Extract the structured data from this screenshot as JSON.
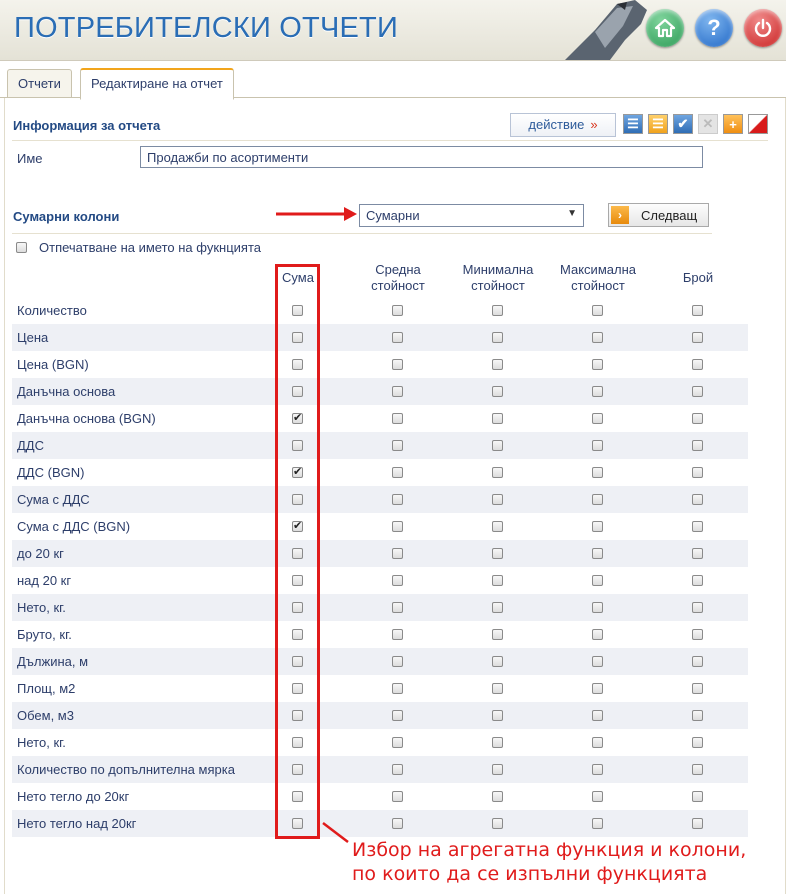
{
  "header": {
    "title": "ПОТРЕБИТЕЛСКИ ОТЧЕТИ",
    "buttons": [
      "home-icon",
      "help-icon",
      "power-icon"
    ]
  },
  "tabs": [
    {
      "label": "Отчети",
      "active": false
    },
    {
      "label": "Редактиране на отчет",
      "active": true
    }
  ],
  "info": {
    "title": "Информация за отчета",
    "action_label": "действие",
    "action_arrow": "»",
    "name_label": "Име",
    "name_value": "Продажби по асортименти"
  },
  "summary": {
    "title": "Сумарни колони",
    "select_value": "Сумарни",
    "next_label": "Следващ",
    "print_function_label": "Отпечатване на името на фукнцията"
  },
  "columns": [
    {
      "line1": "Сума",
      "line2": ""
    },
    {
      "line1": "Средна",
      "line2": "стойност"
    },
    {
      "line1": "Минимална",
      "line2": "стойност"
    },
    {
      "line1": "Максимална",
      "line2": "стойност"
    },
    {
      "line1": "Брой",
      "line2": ""
    }
  ],
  "rows": [
    {
      "name": "Количество",
      "checks": [
        false,
        false,
        false,
        false,
        false
      ]
    },
    {
      "name": "Цена",
      "checks": [
        false,
        false,
        false,
        false,
        false
      ]
    },
    {
      "name": "Цена (BGN)",
      "checks": [
        false,
        false,
        false,
        false,
        false
      ]
    },
    {
      "name": "Данъчна основа",
      "checks": [
        false,
        false,
        false,
        false,
        false
      ]
    },
    {
      "name": "Данъчна основа (BGN)",
      "checks": [
        true,
        false,
        false,
        false,
        false
      ]
    },
    {
      "name": "ДДС",
      "checks": [
        false,
        false,
        false,
        false,
        false
      ]
    },
    {
      "name": "ДДС (BGN)",
      "checks": [
        true,
        false,
        false,
        false,
        false
      ]
    },
    {
      "name": "Сума с ДДС",
      "checks": [
        false,
        false,
        false,
        false,
        false
      ]
    },
    {
      "name": "Сума с ДДС (BGN)",
      "checks": [
        true,
        false,
        false,
        false,
        false
      ]
    },
    {
      "name": "до 20 кг",
      "checks": [
        false,
        false,
        false,
        false,
        false
      ]
    },
    {
      "name": "над 20 кг",
      "checks": [
        false,
        false,
        false,
        false,
        false
      ]
    },
    {
      "name": "Нето, кг.",
      "checks": [
        false,
        false,
        false,
        false,
        false
      ]
    },
    {
      "name": "Бруто, кг.",
      "checks": [
        false,
        false,
        false,
        false,
        false
      ]
    },
    {
      "name": "Дължина, м",
      "checks": [
        false,
        false,
        false,
        false,
        false
      ]
    },
    {
      "name": "Площ, м2",
      "checks": [
        false,
        false,
        false,
        false,
        false
      ]
    },
    {
      "name": "Обем, м3",
      "checks": [
        false,
        false,
        false,
        false,
        false
      ]
    },
    {
      "name": "Нето, кг.",
      "checks": [
        false,
        false,
        false,
        false,
        false
      ]
    },
    {
      "name": "Количество по допълнителна мярка",
      "checks": [
        false,
        false,
        false,
        false,
        false
      ]
    },
    {
      "name": "Нето тегло до 20кг",
      "checks": [
        false,
        false,
        false,
        false,
        false
      ]
    },
    {
      "name": "Нето тегло над 20кг",
      "checks": [
        false,
        false,
        false,
        false,
        false
      ]
    }
  ],
  "annotation": {
    "line1": "Избор на агрегатна функция и колони,",
    "line2": "по които да се изпълни функцията"
  },
  "colors": {
    "accent": "#2a6db5",
    "annotation": "#e01b1b",
    "tab_highlight": "#f2a51b"
  }
}
